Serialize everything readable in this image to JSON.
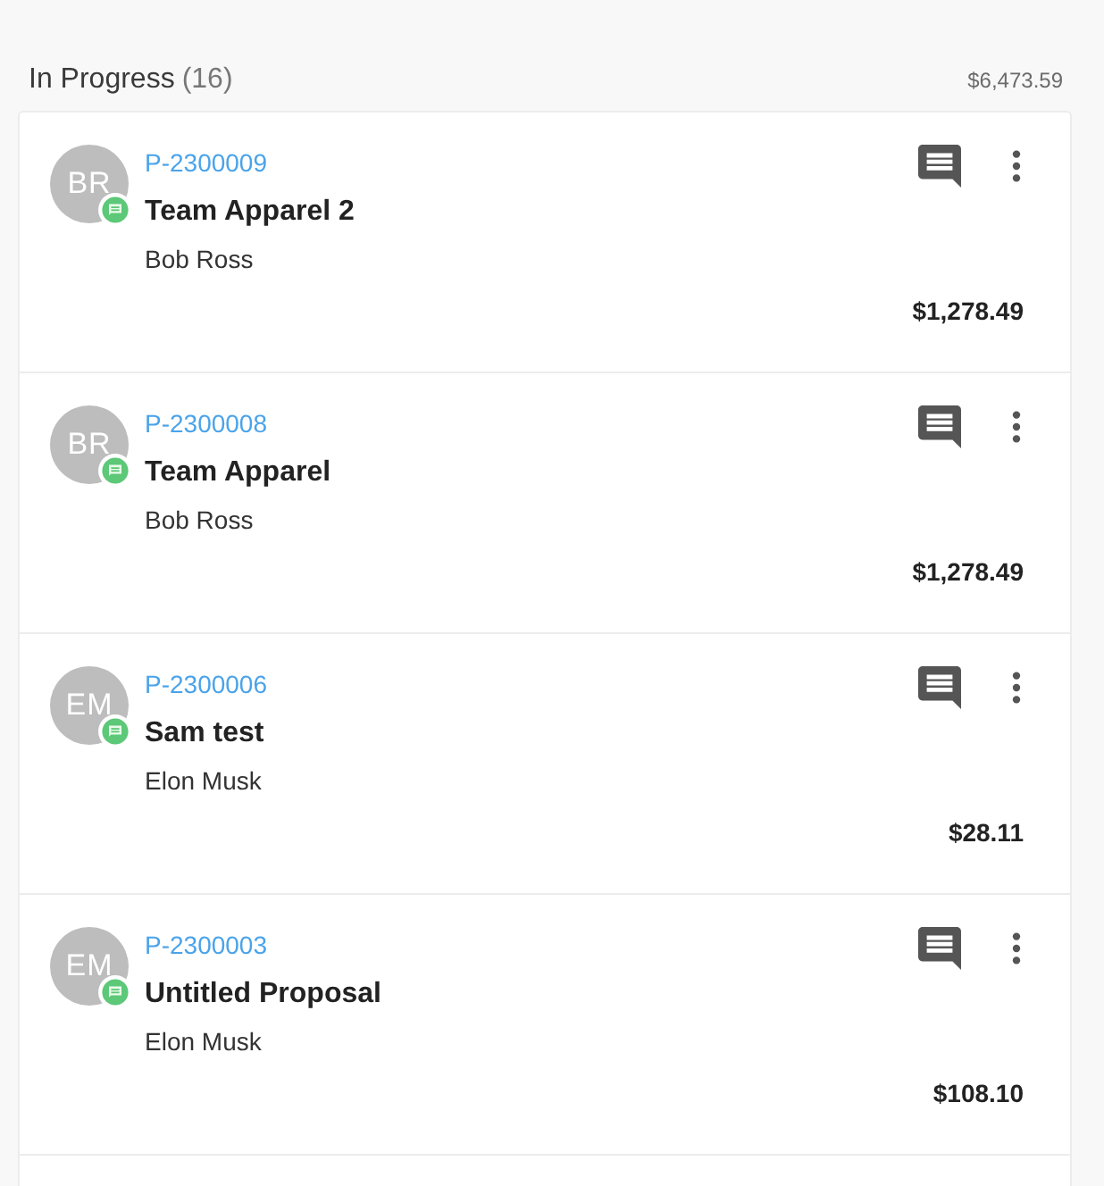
{
  "column": {
    "title": "In Progress",
    "count": "(16)",
    "total": "$6,473.59"
  },
  "proposals": [
    {
      "initials": "BR",
      "number": "P-2300009",
      "title": "Team Apparel 2",
      "client": "Bob Ross",
      "amount": "$1,278.49"
    },
    {
      "initials": "BR",
      "number": "P-2300008",
      "title": "Team Apparel",
      "client": "Bob Ross",
      "amount": "$1,278.49"
    },
    {
      "initials": "EM",
      "number": "P-2300006",
      "title": "Sam test",
      "client": "Elon Musk",
      "amount": "$28.11"
    },
    {
      "initials": "EM",
      "number": "P-2300003",
      "title": "Untitled Proposal",
      "client": "Elon Musk",
      "amount": "$108.10"
    }
  ]
}
